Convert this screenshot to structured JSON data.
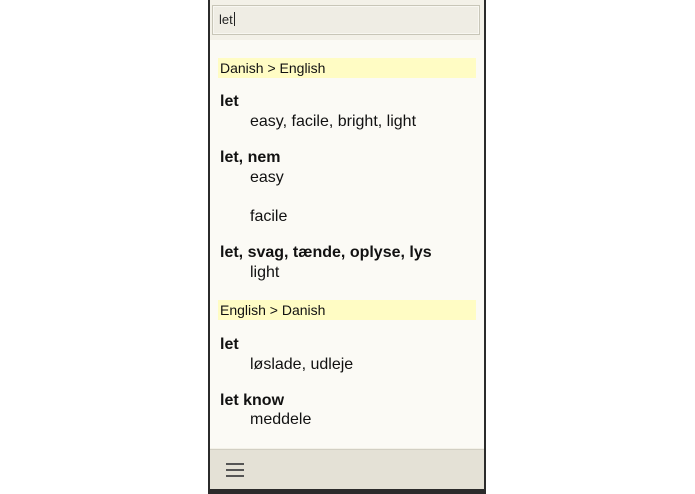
{
  "search": {
    "value": "let"
  },
  "sections": [
    {
      "header": "Danish > English",
      "entries": [
        {
          "headword": "let",
          "translations": [
            "easy, facile, bright, light"
          ]
        },
        {
          "headword": "let, nem",
          "translations": [
            "easy",
            "facile"
          ]
        },
        {
          "headword": "let, svag, tænde, oplyse, lys",
          "translations": [
            "light"
          ]
        }
      ]
    },
    {
      "header": "English > Danish",
      "entries": [
        {
          "headword": "let",
          "translations": [
            "løslade, udleje"
          ]
        },
        {
          "headword": "let know",
          "translations": [
            "meddele"
          ]
        }
      ]
    }
  ],
  "toolbar": {
    "menu_icon": "menu-icon"
  }
}
